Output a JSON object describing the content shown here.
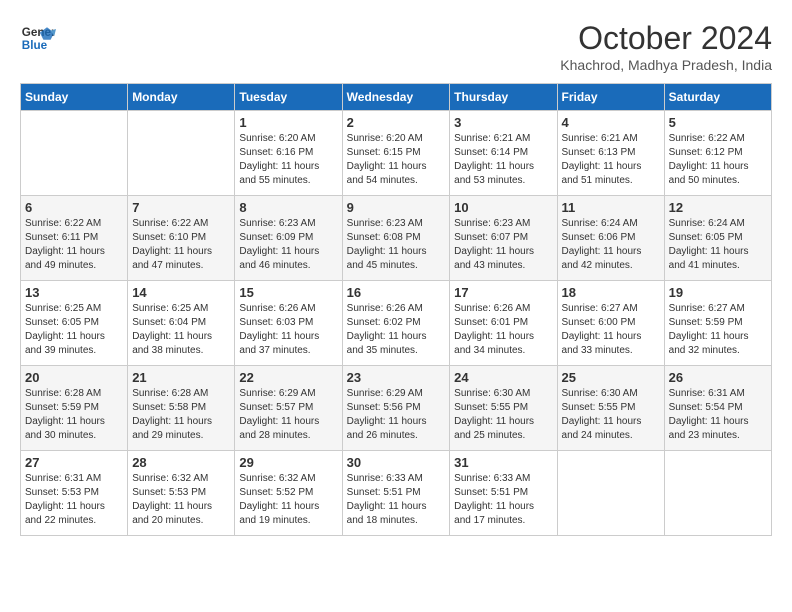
{
  "logo": {
    "line1": "General",
    "line2": "Blue"
  },
  "title": "October 2024",
  "subtitle": "Khachrod, Madhya Pradesh, India",
  "days_header": [
    "Sunday",
    "Monday",
    "Tuesday",
    "Wednesday",
    "Thursday",
    "Friday",
    "Saturday"
  ],
  "weeks": [
    [
      {
        "day": "",
        "info": ""
      },
      {
        "day": "",
        "info": ""
      },
      {
        "day": "1",
        "info": "Sunrise: 6:20 AM\nSunset: 6:16 PM\nDaylight: 11 hours and 55 minutes."
      },
      {
        "day": "2",
        "info": "Sunrise: 6:20 AM\nSunset: 6:15 PM\nDaylight: 11 hours and 54 minutes."
      },
      {
        "day": "3",
        "info": "Sunrise: 6:21 AM\nSunset: 6:14 PM\nDaylight: 11 hours and 53 minutes."
      },
      {
        "day": "4",
        "info": "Sunrise: 6:21 AM\nSunset: 6:13 PM\nDaylight: 11 hours and 51 minutes."
      },
      {
        "day": "5",
        "info": "Sunrise: 6:22 AM\nSunset: 6:12 PM\nDaylight: 11 hours and 50 minutes."
      }
    ],
    [
      {
        "day": "6",
        "info": "Sunrise: 6:22 AM\nSunset: 6:11 PM\nDaylight: 11 hours and 49 minutes."
      },
      {
        "day": "7",
        "info": "Sunrise: 6:22 AM\nSunset: 6:10 PM\nDaylight: 11 hours and 47 minutes."
      },
      {
        "day": "8",
        "info": "Sunrise: 6:23 AM\nSunset: 6:09 PM\nDaylight: 11 hours and 46 minutes."
      },
      {
        "day": "9",
        "info": "Sunrise: 6:23 AM\nSunset: 6:08 PM\nDaylight: 11 hours and 45 minutes."
      },
      {
        "day": "10",
        "info": "Sunrise: 6:23 AM\nSunset: 6:07 PM\nDaylight: 11 hours and 43 minutes."
      },
      {
        "day": "11",
        "info": "Sunrise: 6:24 AM\nSunset: 6:06 PM\nDaylight: 11 hours and 42 minutes."
      },
      {
        "day": "12",
        "info": "Sunrise: 6:24 AM\nSunset: 6:05 PM\nDaylight: 11 hours and 41 minutes."
      }
    ],
    [
      {
        "day": "13",
        "info": "Sunrise: 6:25 AM\nSunset: 6:05 PM\nDaylight: 11 hours and 39 minutes."
      },
      {
        "day": "14",
        "info": "Sunrise: 6:25 AM\nSunset: 6:04 PM\nDaylight: 11 hours and 38 minutes."
      },
      {
        "day": "15",
        "info": "Sunrise: 6:26 AM\nSunset: 6:03 PM\nDaylight: 11 hours and 37 minutes."
      },
      {
        "day": "16",
        "info": "Sunrise: 6:26 AM\nSunset: 6:02 PM\nDaylight: 11 hours and 35 minutes."
      },
      {
        "day": "17",
        "info": "Sunrise: 6:26 AM\nSunset: 6:01 PM\nDaylight: 11 hours and 34 minutes."
      },
      {
        "day": "18",
        "info": "Sunrise: 6:27 AM\nSunset: 6:00 PM\nDaylight: 11 hours and 33 minutes."
      },
      {
        "day": "19",
        "info": "Sunrise: 6:27 AM\nSunset: 5:59 PM\nDaylight: 11 hours and 32 minutes."
      }
    ],
    [
      {
        "day": "20",
        "info": "Sunrise: 6:28 AM\nSunset: 5:59 PM\nDaylight: 11 hours and 30 minutes."
      },
      {
        "day": "21",
        "info": "Sunrise: 6:28 AM\nSunset: 5:58 PM\nDaylight: 11 hours and 29 minutes."
      },
      {
        "day": "22",
        "info": "Sunrise: 6:29 AM\nSunset: 5:57 PM\nDaylight: 11 hours and 28 minutes."
      },
      {
        "day": "23",
        "info": "Sunrise: 6:29 AM\nSunset: 5:56 PM\nDaylight: 11 hours and 26 minutes."
      },
      {
        "day": "24",
        "info": "Sunrise: 6:30 AM\nSunset: 5:55 PM\nDaylight: 11 hours and 25 minutes."
      },
      {
        "day": "25",
        "info": "Sunrise: 6:30 AM\nSunset: 5:55 PM\nDaylight: 11 hours and 24 minutes."
      },
      {
        "day": "26",
        "info": "Sunrise: 6:31 AM\nSunset: 5:54 PM\nDaylight: 11 hours and 23 minutes."
      }
    ],
    [
      {
        "day": "27",
        "info": "Sunrise: 6:31 AM\nSunset: 5:53 PM\nDaylight: 11 hours and 22 minutes."
      },
      {
        "day": "28",
        "info": "Sunrise: 6:32 AM\nSunset: 5:53 PM\nDaylight: 11 hours and 20 minutes."
      },
      {
        "day": "29",
        "info": "Sunrise: 6:32 AM\nSunset: 5:52 PM\nDaylight: 11 hours and 19 minutes."
      },
      {
        "day": "30",
        "info": "Sunrise: 6:33 AM\nSunset: 5:51 PM\nDaylight: 11 hours and 18 minutes."
      },
      {
        "day": "31",
        "info": "Sunrise: 6:33 AM\nSunset: 5:51 PM\nDaylight: 11 hours and 17 minutes."
      },
      {
        "day": "",
        "info": ""
      },
      {
        "day": "",
        "info": ""
      }
    ]
  ]
}
